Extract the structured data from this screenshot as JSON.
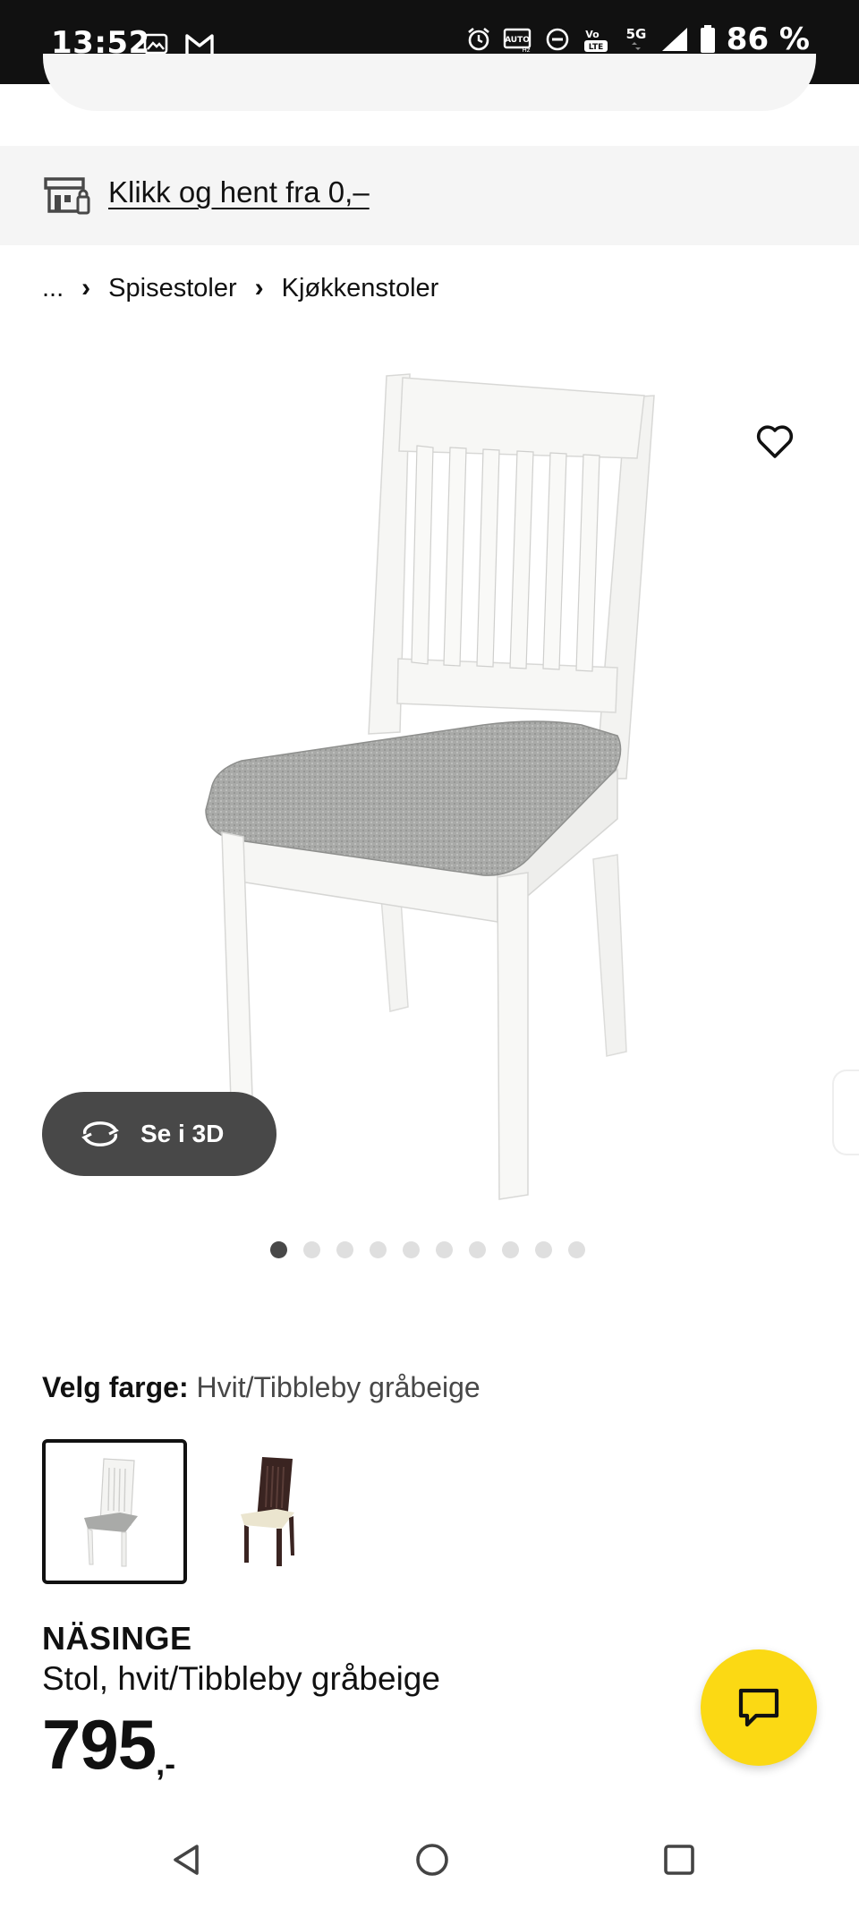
{
  "status_bar": {
    "time": "13:52",
    "battery_text": "86 %",
    "network": "5G",
    "icons": [
      "gallery-icon",
      "gmail-icon",
      "alarm-icon",
      "auto-hz-icon",
      "dnd-icon",
      "volte-icon",
      "signal-icon",
      "battery-icon"
    ]
  },
  "banner": {
    "text": "Klikk og hent fra 0,–",
    "icon": "store-pickup-icon"
  },
  "breadcrumb": {
    "items": [
      "...",
      "Spisestoler",
      "Kjøkkenstoler"
    ]
  },
  "gallery": {
    "view3d_label": "Se i 3D",
    "dot_count": 10,
    "active_index": 0
  },
  "color": {
    "label": "Velg farge:",
    "value": "Hvit/Tibbleby gråbeige"
  },
  "product": {
    "name": "NÄSINGE",
    "description": "Stol, hvit/Tibbleby gråbeige",
    "price": "795",
    "price_suffix": ",-"
  },
  "colors": {
    "accent_yellow": "#fbd914",
    "dark_button": "#484848",
    "banner_bg": "#f5f5f5"
  }
}
